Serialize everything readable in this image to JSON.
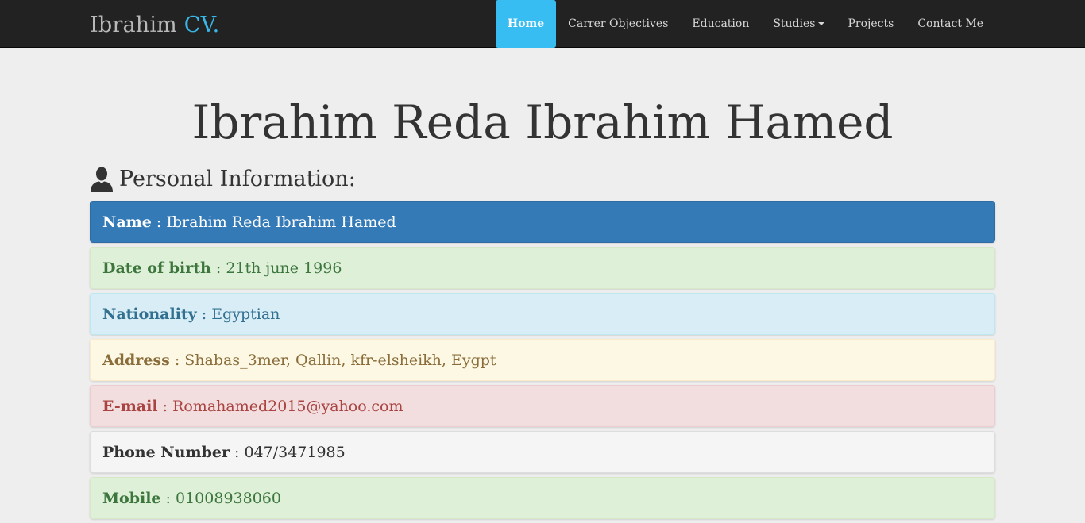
{
  "navbar": {
    "brand_name": "Ibrahim",
    "brand_suffix": "CV.",
    "items": [
      {
        "label": "Home"
      },
      {
        "label": "Carrer Objectives"
      },
      {
        "label": "Education"
      },
      {
        "label": "Studies"
      },
      {
        "label": "Projects"
      },
      {
        "label": "Contact Me"
      }
    ]
  },
  "page": {
    "title": "Ibrahim Reda Ibrahim Hamed",
    "section_heading": "Personal Information:"
  },
  "personal_info": [
    {
      "label": "Name",
      "value": "Ibrahim Reda Ibrahim Hamed"
    },
    {
      "label": "Date of birth",
      "value": "21th june 1996"
    },
    {
      "label": "Nationality",
      "value": "Egyptian"
    },
    {
      "label": "Address",
      "value": "Shabas_3mer, Qallin, kfr-elsheikh, Eygpt"
    },
    {
      "label": "E-mail",
      "value": "Romahamed2015@yahoo.com"
    },
    {
      "label": "Phone Number",
      "value": "047/3471985"
    },
    {
      "label": "Mobile",
      "value": "01008938060"
    }
  ],
  "separator": " : ",
  "icons": {
    "section_icon": "user-icon",
    "dropdown_icon": "caret-down-icon"
  },
  "colors": {
    "navbar_bg": "#222222",
    "brand_accent": "#38b6e8",
    "active_nav": "#38bdf2",
    "primary": "#337ab7",
    "success": "#dff0d8",
    "info": "#d9edf7",
    "warning": "#fcf8e3",
    "danger": "#f2dede",
    "default": "#f5f5f5"
  }
}
